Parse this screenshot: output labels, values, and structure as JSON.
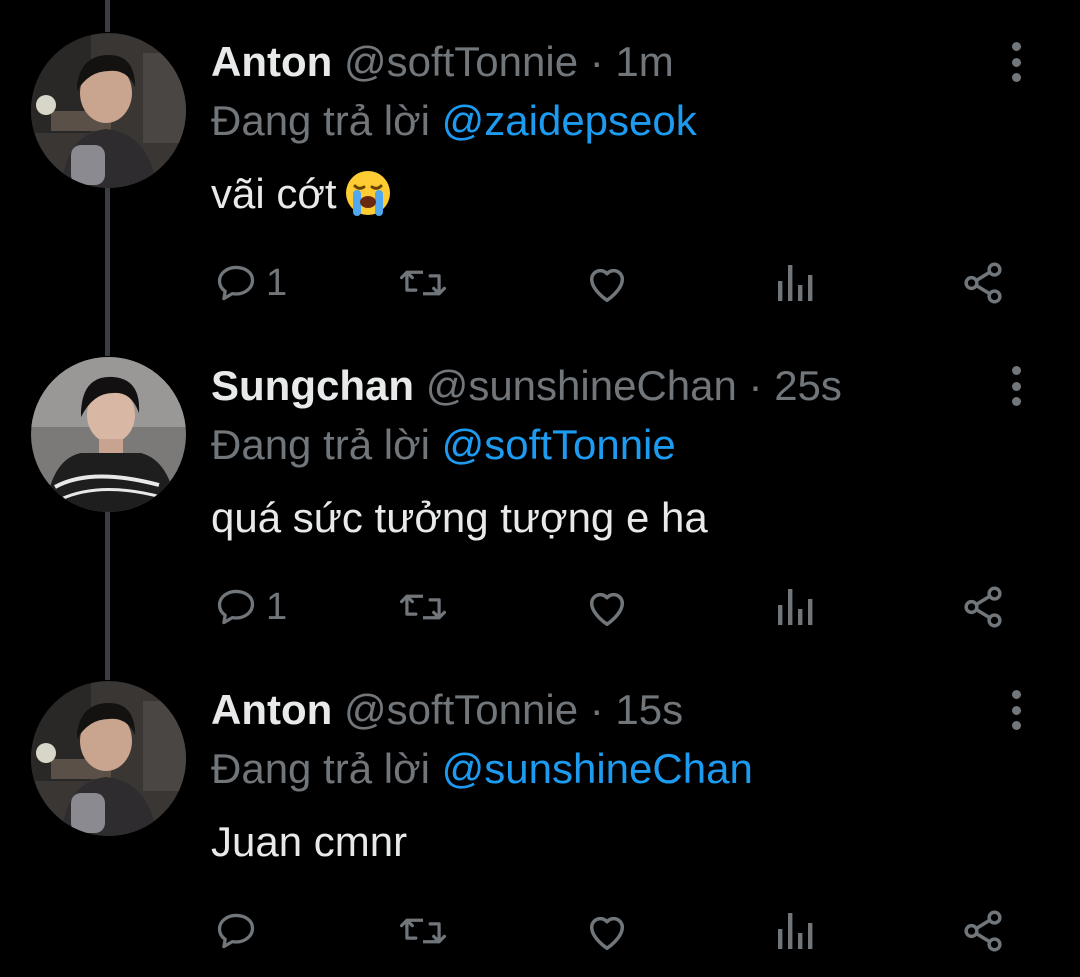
{
  "colors": {
    "background": "#000000",
    "text_primary": "#e7e9ea",
    "text_secondary": "#71767b",
    "accent": "#1d9bf0",
    "thread_line": "#3a3e42"
  },
  "tweets": [
    {
      "display_name": "Anton",
      "handle": "@softTonnie",
      "separator": "·",
      "time": "1m",
      "reply_prefix": "Đang trả lời",
      "reply_mention": "@zaidepseok",
      "text": "vãi cớt",
      "emoji": "loudly-crying-face",
      "reply_count": "1",
      "avatar_icon": "avatar-anton"
    },
    {
      "display_name": "Sungchan",
      "handle": "@sunshineChan",
      "separator": "·",
      "time": "25s",
      "reply_prefix": "Đang trả lời",
      "reply_mention": "@softTonnie",
      "text": "quá sức tưởng tượng e ha",
      "reply_count": "1",
      "avatar_icon": "avatar-sungchan"
    },
    {
      "display_name": "Anton",
      "handle": "@softTonnie",
      "separator": "·",
      "time": "15s",
      "reply_prefix": "Đang trả lời",
      "reply_mention": "@sunshineChan",
      "text": "Juan cmnr",
      "reply_count": "",
      "avatar_icon": "avatar-anton"
    }
  ],
  "icons": {
    "reply": "reply-icon",
    "retweet": "retweet-icon",
    "like": "like-icon",
    "views": "views-icon",
    "share": "share-icon",
    "more": "more-options-icon"
  }
}
